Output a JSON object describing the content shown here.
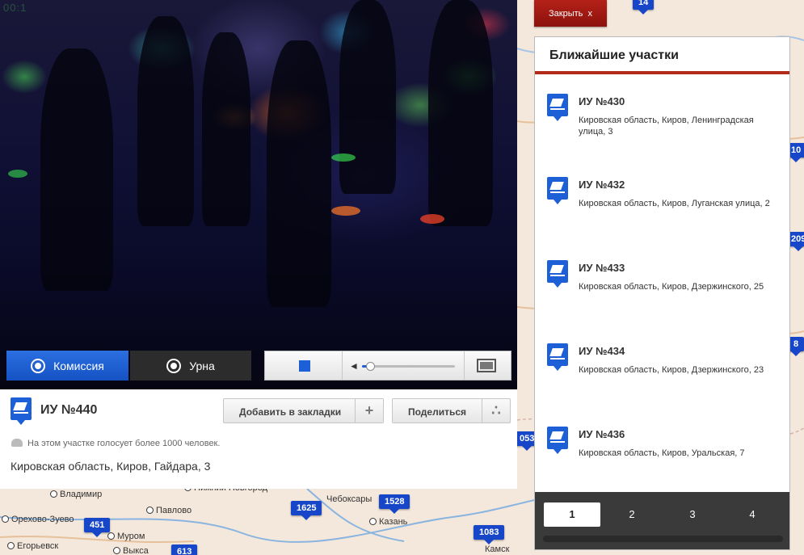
{
  "map": {
    "cities": [
      {
        "name": "Владимир"
      },
      {
        "name": "Нижний Новгород"
      },
      {
        "name": "Чебоксары"
      },
      {
        "name": "Орехово-Зуево"
      },
      {
        "name": "Павлово"
      },
      {
        "name": "Муром"
      },
      {
        "name": "Казань"
      },
      {
        "name": "Егорьевск"
      },
      {
        "name": "Выкса"
      },
      {
        "name": "Камск"
      }
    ],
    "markers": [
      "14",
      "1625",
      "1528",
      "451",
      "1083",
      "613",
      "10",
      "209",
      "8",
      "053"
    ]
  },
  "video": {
    "overlay_text": "00:1"
  },
  "camera": {
    "commission_label": "Комиссия",
    "urn_label": "Урна"
  },
  "player": {
    "volume": 0.05
  },
  "station": {
    "title": "ИУ №440",
    "bookmark_label": "Добавить в закладки",
    "bookmark_side": "+",
    "share_label": "Поделиться",
    "voters_note": "На этом участке голосует более 1000 человек.",
    "address": "Кировская область, Киров, Гайдара, 3"
  },
  "close": {
    "label": "Закрыть",
    "icon": "x"
  },
  "nearest": {
    "title": "Ближайшие участки",
    "items": [
      {
        "title": "ИУ №430",
        "address": "Кировская область, Киров, Ленинградская улица, 3"
      },
      {
        "title": "ИУ №432",
        "address": "Кировская область, Киров, Луганская улица, 2"
      },
      {
        "title": "ИУ №433",
        "address": "Кировская область, Киров, Дзержинского, 25"
      },
      {
        "title": "ИУ №434",
        "address": "Кировская область, Киров, Дзержинского, 23"
      },
      {
        "title": "ИУ №436",
        "address": "Кировская область, Киров, Уральская, 7"
      }
    ],
    "pages": [
      "1",
      "2",
      "3",
      "4"
    ],
    "active_page": "1"
  },
  "colors": {
    "accent_blue": "#1d5fd6",
    "close_red": "#a0180f",
    "title_rule": "#b22a1a",
    "pager_bg": "#3a3a3a"
  }
}
